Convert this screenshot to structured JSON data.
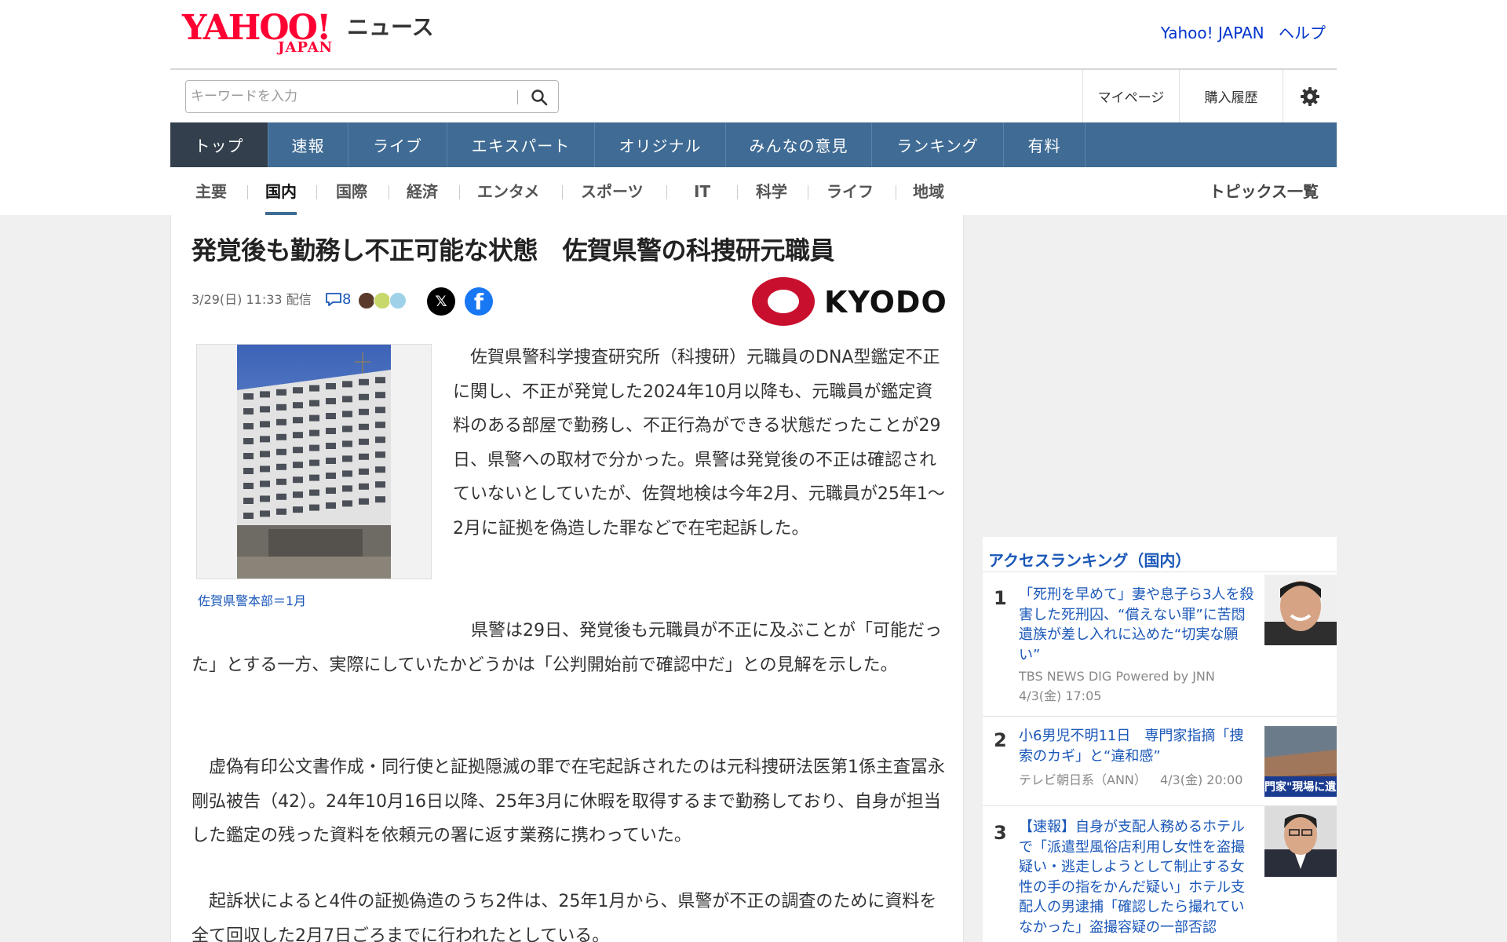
{
  "header": {
    "logo_text": "YAHOO!",
    "logo_sub": "JAPAN",
    "section_title": "ニュース",
    "links": [
      "Yahoo! JAPAN",
      "ヘルプ"
    ]
  },
  "search": {
    "placeholder": "キーワードを入力"
  },
  "utility": {
    "mypage": "マイページ",
    "history": "購入履歴"
  },
  "main_nav": [
    "トップ",
    "速報",
    "ライブ",
    "エキスパート",
    "オリジナル",
    "みんなの意見",
    "ランキング",
    "有料"
  ],
  "sub_nav": [
    "主要",
    "国内",
    "国際",
    "経済",
    "エンタメ",
    "スポーツ",
    "IT",
    "科学",
    "ライフ",
    "地域"
  ],
  "sub_nav_active": "国内",
  "topics_link": "トピックス一覧",
  "article": {
    "title": "発覚後も勤務し不正可能な状態　佐賀県警の科捜研元職員",
    "date": "3/29(日) 11:33 配信",
    "comment_count": "8",
    "publisher": "KYODO",
    "caption": "佐賀県警本部＝1月",
    "paragraphs": [
      "佐賀県警科学捜査研究所（科捜研）元職員のDNA型鑑定不正に関し、不正が発覚した2024年10月以降も、元職員が鑑定資料のある部屋で勤務し、不正行為ができる状態だったことが29日、県警への取材で分かった。県警は発覚後の不正は確認されていないとしていたが、佐賀地検は今年2月、元職員が25年1～2月に証拠を偽造した罪などで在宅起訴した。",
      "県警は29日、発覚後も元職員が不正に及ぶことが「可能だった」とする一方、実際にしていたかどうかは「公判開始前で確認中だ」との見解を示した。",
      "虚偽有印公文書作成・同行使と証拠隠滅の罪で在宅起訴されたのは元科捜研法医第1係主査冨永剛弘被告（42）。24年10月16日以降、25年3月に休暇を取得するまで勤務しており、自身が担当した鑑定の残った資料を依頼元の署に返す業務に携わっていた。",
      "起訴状によると4件の証拠偽造のうち2件は、25年1月から、県警が不正の調査のために資料を全て回収した2月7日ごろまでに行われたとしている。"
    ]
  },
  "ranking": {
    "title": "アクセスランキング（国内）",
    "items": [
      {
        "rank": "1",
        "title": "「死刑を早めて」妻や息子ら3人を殺害した死刑囚、“償えない罪”に苦悶　遺族が差し入れに込めた“切実な願い”",
        "source": "TBS NEWS DIG Powered by JNN",
        "time": "4/3(金) 17:05"
      },
      {
        "rank": "2",
        "title": "小6男児不明11日　専門家指摘「捜索のカギ」と“違和感”",
        "source": "テレビ朝日系（ANN）",
        "time": "4/3(金) 20:00",
        "thumb_text": "門家\"現場に遺"
      },
      {
        "rank": "3",
        "title": "【速報】自身が支配人務めるホテルで「派遣型風俗店利用し女性を盗撮疑い・逃走しようとして制止する女性の手の指をかんだ疑い」ホテル支配人の男逮捕「確認したら撮れていなかった」盗撮容疑の一部否認",
        "source": "",
        "time": ""
      }
    ]
  },
  "colors": {
    "nav_blue": "#3f6b94",
    "nav_active": "#333f4c",
    "link_blue": "#1a57b8",
    "yahoo_red": "#ff0033",
    "kyodo_red": "#c8102e"
  }
}
